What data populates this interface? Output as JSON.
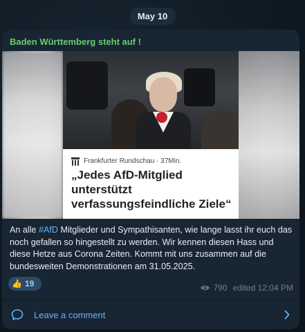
{
  "date_pill": "May 10",
  "message": {
    "channel_name": "Baden Württemberg steht auf !",
    "link_card": {
      "source": "Frankfurter Rundschau · 37Min.",
      "title": "„Jedes AfD-Mitglied unterstützt verfassungsfeindliche Ziele“"
    },
    "text": {
      "before_hashtag": "An alle ",
      "hashtag": "#AfD",
      "after_hashtag": " Mitglieder und Sympathisanten, wie lange lasst ihr euch das noch gefallen so hingestellt zu werden. Wir kennen diesen Hass und diese Hetze aus Corona Zeiten. Kommt mit uns zusammen auf die bundesweiten Demonstrationen am 31.05.2025."
    },
    "reaction": {
      "emoji": "👍",
      "count": "19"
    },
    "views": "790",
    "edited_time": "edited 12:04 PM",
    "comment_label": "Leave a comment"
  },
  "colors": {
    "accent": "#64b5f6",
    "channel_name": "#6ccb6f",
    "bubble": "#182533",
    "hashtag": "#6ab3f3"
  },
  "icons": [
    "eye-icon",
    "comment-icon",
    "chevron-right-icon",
    "newspaper-logo-icon"
  ]
}
